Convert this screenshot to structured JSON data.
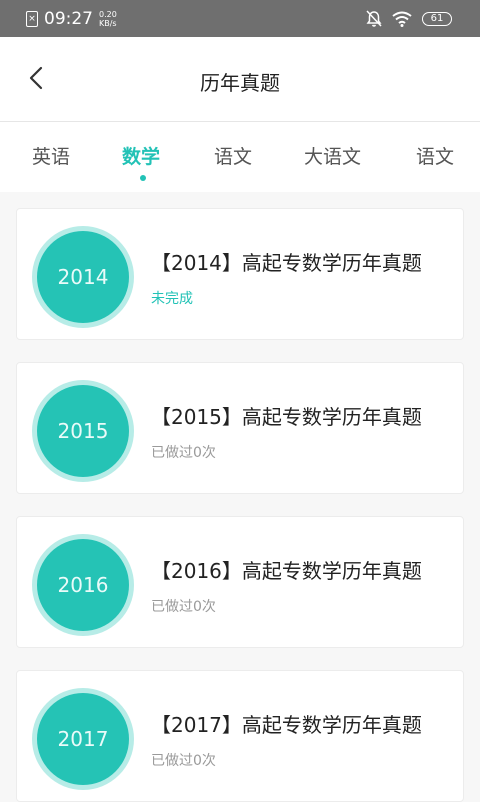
{
  "status_bar": {
    "sim_icon": "sim-off-icon",
    "time": "09:27",
    "speed_value": "0.20",
    "speed_unit": "KB/s",
    "battery": "61"
  },
  "header": {
    "title": "历年真题"
  },
  "tabs": [
    {
      "label": "英语",
      "active": false
    },
    {
      "label": "数学",
      "active": true
    },
    {
      "label": "语文",
      "active": false
    },
    {
      "label": "大语文",
      "active": false
    },
    {
      "label": "语文",
      "active": false
    }
  ],
  "papers": [
    {
      "year": "2014",
      "title": "【2014】高起专数学历年真题",
      "status": "未完成"
    },
    {
      "year": "2015",
      "title": "【2015】高起专数学历年真题",
      "status": "已做过0次"
    },
    {
      "year": "2016",
      "title": "【2016】高起专数学历年真题",
      "status": "已做过0次"
    },
    {
      "year": "2017",
      "title": "【2017】高起专数学历年真题",
      "status": "已做过0次"
    }
  ],
  "colors": {
    "accent": "#22c2b6",
    "circle_fill": "#25c3b5",
    "circle_ring": "#b7ece7"
  }
}
